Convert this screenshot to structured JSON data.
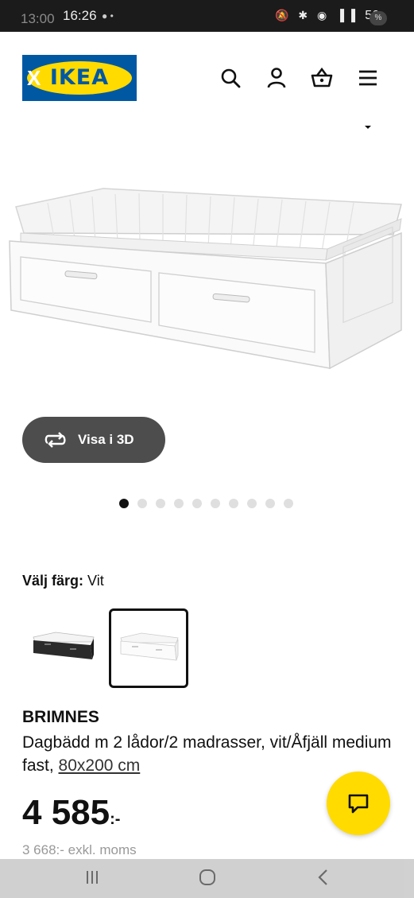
{
  "status_bar": {
    "ghost_time": "13:00",
    "time": "16:26",
    "notif_icons": "● •",
    "sys_icons": "🔕 ✱ ◉ ▐▐",
    "battery": "56",
    "badge": "%"
  },
  "header": {
    "logo_text": "IKEA",
    "logo_x": "X",
    "icons": [
      "search-icon",
      "user-icon",
      "basket-icon",
      "menu-icon"
    ]
  },
  "gallery": {
    "view_3d_label": "Visa i 3D",
    "dot_count": 10,
    "active_dot": 0
  },
  "color_picker": {
    "label": "Välj färg:",
    "value": "Vit",
    "options": [
      "black-brown",
      "white"
    ],
    "selected": 1
  },
  "product": {
    "name": "BRIMNES",
    "description": "Dagbädd m 2 lådor/2 madrasser, vit/Åfjäll medium fast,",
    "size": "80x200 cm",
    "price": "4 585",
    "price_suffix": ":-",
    "price_ex_vat": "3 668:- exkl. moms"
  },
  "colors": {
    "brand_blue": "#0058a3",
    "brand_yellow": "#ffdb00",
    "button_dark": "#4d4d4d"
  }
}
